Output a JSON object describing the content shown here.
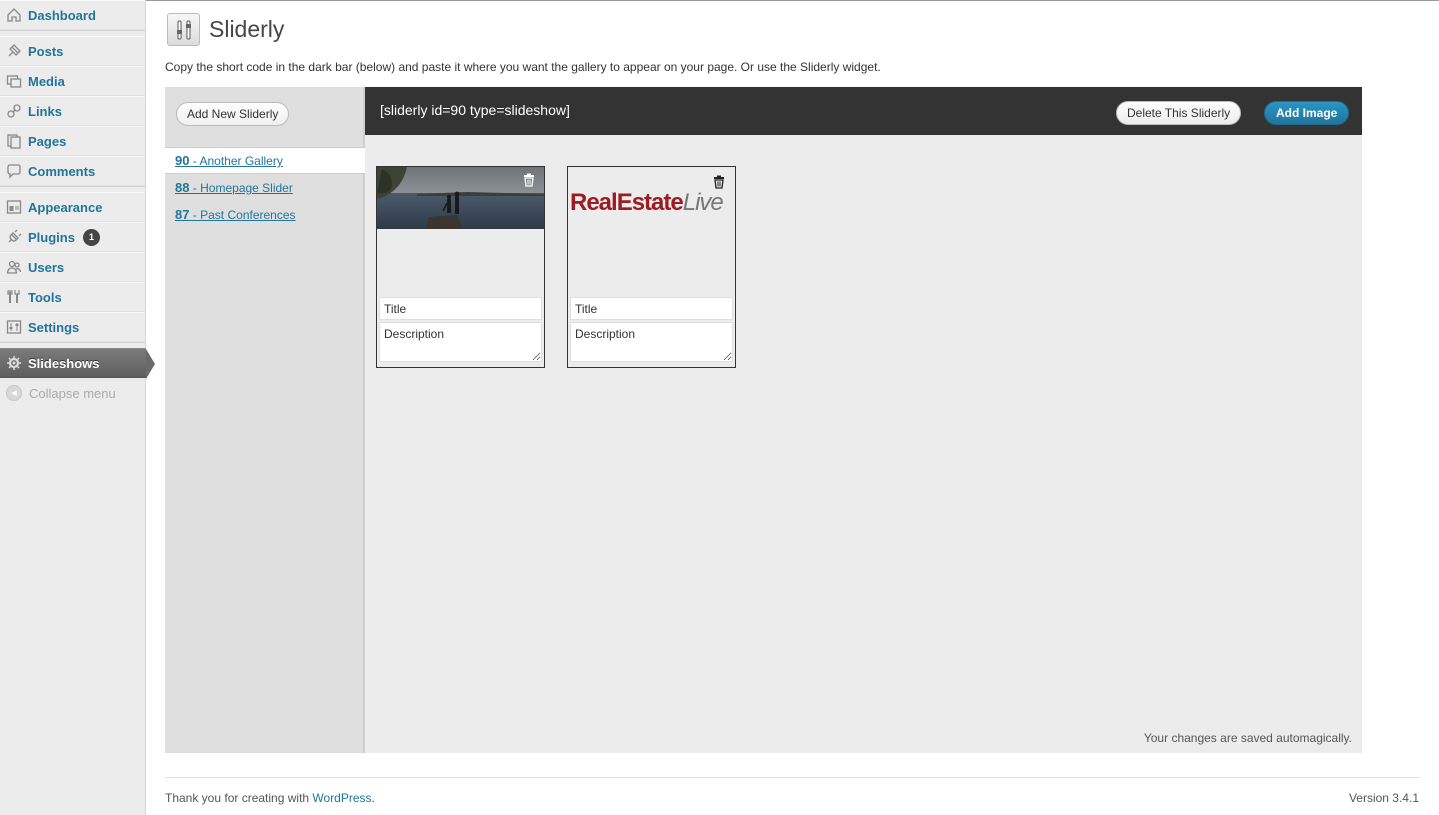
{
  "sidebar": {
    "items": [
      {
        "label": "Dashboard",
        "icon": "dashboard-icon"
      },
      {
        "label": "Posts",
        "icon": "posts-icon"
      },
      {
        "label": "Media",
        "icon": "media-icon"
      },
      {
        "label": "Links",
        "icon": "links-icon"
      },
      {
        "label": "Pages",
        "icon": "pages-icon"
      },
      {
        "label": "Comments",
        "icon": "comments-icon"
      },
      {
        "label": "Appearance",
        "icon": "appearance-icon"
      },
      {
        "label": "Plugins",
        "icon": "plugins-icon",
        "badge": "1"
      },
      {
        "label": "Users",
        "icon": "users-icon"
      },
      {
        "label": "Tools",
        "icon": "tools-icon"
      },
      {
        "label": "Settings",
        "icon": "settings-icon"
      },
      {
        "label": "Slideshows",
        "icon": "slideshows-icon"
      }
    ],
    "collapse_label": "Collapse menu"
  },
  "page": {
    "title": "Sliderly",
    "intro": "Copy the short code in the dark bar (below) and paste it where you want the gallery to appear on your page. Or use the Sliderly widget."
  },
  "sliderly": {
    "add_new_label": "Add New Sliderly",
    "galleries": [
      {
        "id": "90",
        "name": " - Another Gallery"
      },
      {
        "id": "88",
        "name": " - Homepage Slider"
      },
      {
        "id": "87",
        "name": " - Past Conferences"
      }
    ],
    "shortcode": "[sliderly id=90 type=slideshow]",
    "delete_label": "Delete This Sliderly",
    "add_image_label": "Add Image",
    "cards": [
      {
        "title_placeholder": "Title",
        "description_placeholder": "Description"
      },
      {
        "title_placeholder": "Title",
        "description_placeholder": "Description",
        "logo_text_main": "RealEstate",
        "logo_text_italic": "Live"
      }
    ],
    "saved_note": "Your changes are saved automagically."
  },
  "footer": {
    "thanks_prefix": "Thank you for creating with ",
    "wordpress_link": "WordPress",
    "thanks_suffix": ".",
    "version": "Version 3.4.1"
  },
  "colors": {
    "accent": "#21759b",
    "dark_bar": "#333333",
    "logo_red": "#9b1c23"
  }
}
